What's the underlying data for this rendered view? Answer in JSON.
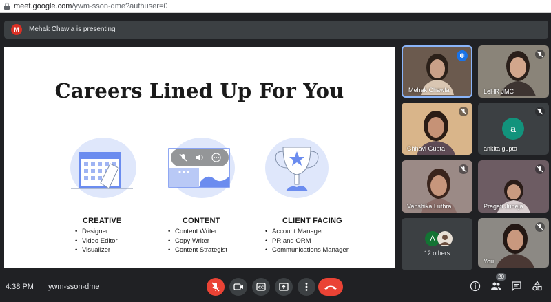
{
  "browser": {
    "url_host": "meet.google.com",
    "url_path": "/ywm-sson-dme?authuser=0"
  },
  "presenting_bar": {
    "avatar_letter": "M",
    "text": "Mehak Chawla is presenting"
  },
  "slide": {
    "title": "Careers Lined Up For You",
    "columns": [
      {
        "heading": "CREATIVE",
        "items": [
          "Designer",
          "Video Editor",
          "Visualizer"
        ]
      },
      {
        "heading": "CONTENT",
        "items": [
          "Content Writer",
          "Copy Writer",
          "Content Strategist"
        ]
      },
      {
        "heading": "CLIENT FACING",
        "items": [
          "Account Manager",
          "PR and ORM",
          "Communications Manager"
        ]
      }
    ]
  },
  "participants": [
    {
      "name": "Mehak Chawla",
      "speaking": true
    },
    {
      "name": "LeHR JMC",
      "muted": true
    },
    {
      "name": "Chhavi Gupta",
      "muted": true
    },
    {
      "name": "ankita gupta",
      "muted": true,
      "avatar_letter": "a",
      "avatar_color": "#12937c"
    },
    {
      "name": "Vanshika Luthra",
      "muted": true
    },
    {
      "name": "Pragati Juneja",
      "muted": true
    },
    {
      "name": "12 others",
      "avatar_letter": "A",
      "avatar_color": "#137333"
    },
    {
      "name": "You",
      "muted": true
    }
  ],
  "bottom_bar": {
    "time": "4:38 PM",
    "separator": "|",
    "meeting_code": "ywm-sson-dme",
    "participant_count": "20"
  },
  "colors": {
    "accent_blue": "#1a73e8",
    "danger_red": "#ea4335",
    "blob_blue": "#dfe7fb",
    "illustration_blue": "#6b8cef"
  }
}
